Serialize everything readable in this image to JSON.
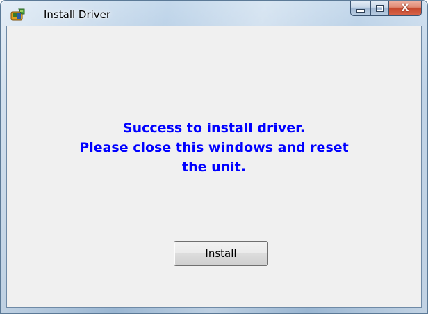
{
  "window": {
    "title": "Install Driver",
    "app_icon": "driver-install-icon",
    "caption": {
      "minimize_icon": "minimize-icon",
      "maximize_icon": "maximize-icon",
      "close_icon": "close-icon",
      "close_glyph": "X"
    }
  },
  "message": {
    "lines": [
      "Success to install driver.",
      "Please close this windows and reset",
      "the unit."
    ],
    "color": "#0000ff"
  },
  "install_button": {
    "label": "Install"
  }
}
